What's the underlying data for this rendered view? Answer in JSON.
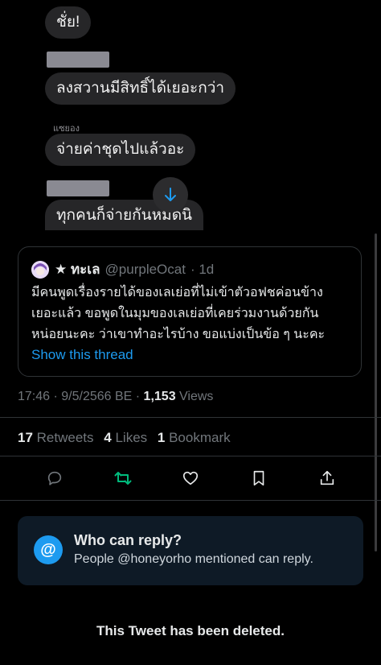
{
  "chat": {
    "messages": [
      {
        "text": "ชั่ย!"
      },
      {
        "text": "ลงสวานมีสิทธิ์ได้เยอะกว่า"
      },
      {
        "text": "จ่ายค่าชุดไปแล้วอะ"
      },
      {
        "text": "ทุกคนก็จ่ายกันหมดนิ"
      }
    ],
    "sender_name": "แซยอง",
    "scroll_icon": "arrow-down-icon"
  },
  "quote": {
    "display_name": "★ ทะเล",
    "handle": "@purpleOcat",
    "age": "· 1d",
    "lines": [
      "มีคนพูดเรื่องรายได้ของเลเย่อที่ไม่เข้าตัวอฟชค่อนข้าง",
      "เยอะแล้ว ขอพูดในมุมของเลเย่อที่เคยร่วมงานด้วยกัน",
      "หน่อยนะคะ ว่าเขาทำอะไรบ้าง ขอแบ่งเป็นข้อ ๆ นะคะ"
    ],
    "show_thread": "Show this thread"
  },
  "meta": {
    "time_date": "17:46 · 9/5/2566 BE · ",
    "views_count": "1,153",
    "views_label": " Views"
  },
  "stats": {
    "retweets_count": "17",
    "retweets_label": "Retweets",
    "likes_count": "4",
    "likes_label": "Likes",
    "bookmarks_count": "1",
    "bookmarks_label": "Bookmark"
  },
  "actions": [
    "reply-icon",
    "retweet-icon",
    "like-icon",
    "bookmark-icon",
    "share-icon"
  ],
  "colors": {
    "retweet_active": "#00ba7c",
    "link": "#1d9bf0",
    "accent": "#1d9bf0"
  },
  "reply_restriction": {
    "icon": "@",
    "title": "Who can reply?",
    "subtitle": "People @honeyorho mentioned can reply."
  },
  "deleted_notice": "This Tweet has been deleted."
}
